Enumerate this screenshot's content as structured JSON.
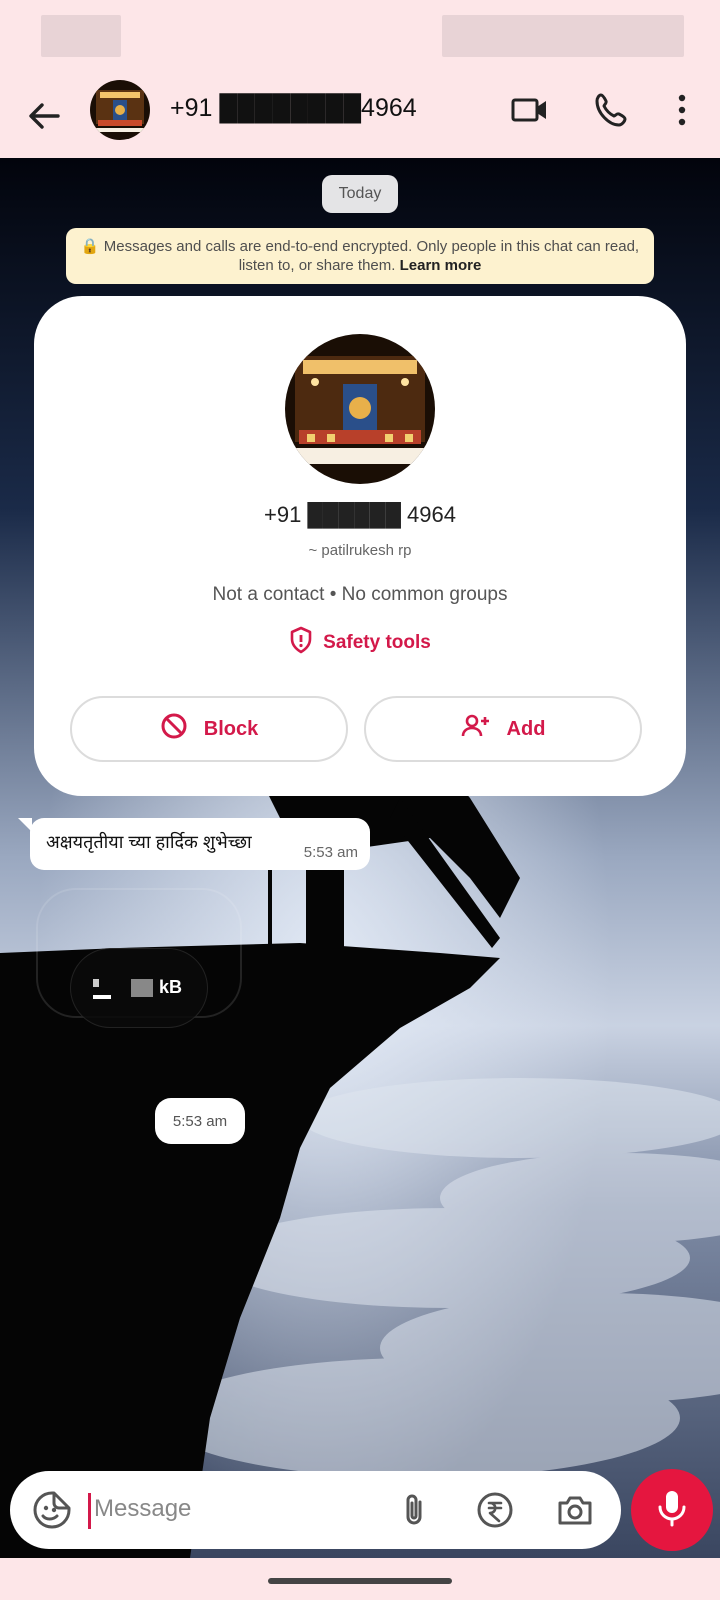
{
  "header": {
    "contact_title": "+91 ████████4964",
    "video_icon": "video-call-icon",
    "call_icon": "voice-call-icon",
    "menu_icon": "more-vert-icon"
  },
  "chat": {
    "date_chip": "Today",
    "encryption_notice": "Messages and calls are end-to-end encrypted. Only people in this chat can read, listen to, or share them.",
    "encryption_link": "Learn more"
  },
  "contact_card": {
    "phone": "+91 ██████ 4964",
    "display_name": "~ patilrukesh rp",
    "meta": "Not a contact • No common groups",
    "safety_label": "Safety tools",
    "block_label": "Block",
    "add_label": "Add"
  },
  "messages": [
    {
      "text": "अक्षयतृतीया च्या हार्दिक शुभेच्छा",
      "time": "5:53 am"
    }
  ],
  "attachment": {
    "size_label": "kB",
    "time": "5:53 am"
  },
  "composer": {
    "placeholder": "Message",
    "emoji_icon": "sticker-icon",
    "attach_icon": "paperclip-icon",
    "payment_icon": "rupee-icon",
    "camera_icon": "camera-icon",
    "mic_icon": "mic-icon"
  },
  "colors": {
    "accent": "#d3194a",
    "mic_button": "#e5163f",
    "app_bar": "#fde6e8",
    "encryption_banner": "#fdf2cf"
  }
}
